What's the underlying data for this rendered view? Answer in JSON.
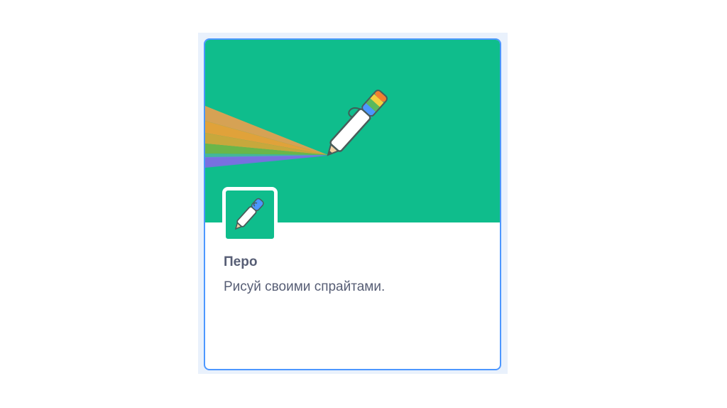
{
  "extension_card": {
    "title": "Перо",
    "description": "Рисуй своими спрайтами.",
    "banner_icon": "pen-rainbow-icon",
    "badge_icon": "pen-icon",
    "colors": {
      "accent_border": "#4c97ff",
      "banner_green": "#0fbd8c",
      "text": "#575e75"
    }
  }
}
